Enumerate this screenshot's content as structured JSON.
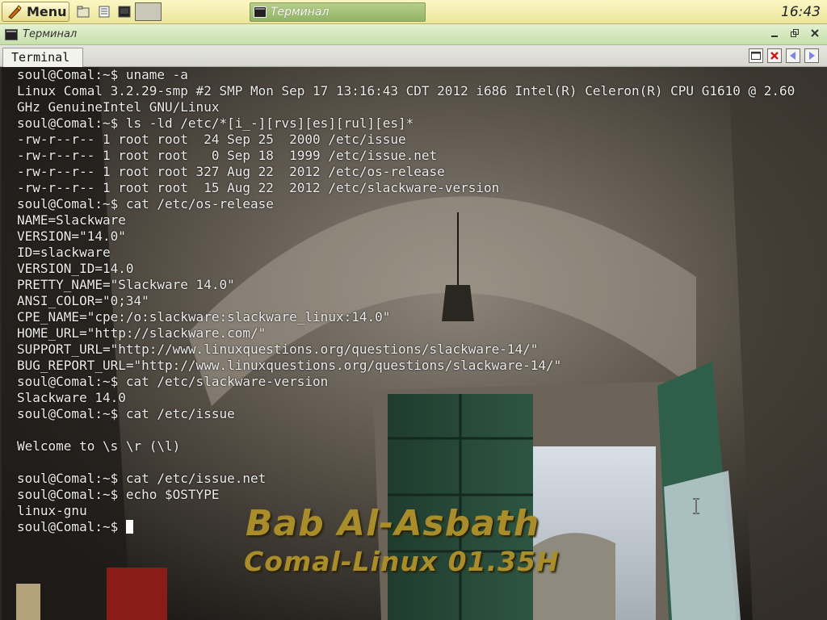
{
  "panel": {
    "menu_label": "Menu",
    "task_title": "Терминал",
    "clock": "16:43",
    "launchers": [
      "files-icon",
      "notes-icon",
      "terminal-icon"
    ]
  },
  "window": {
    "title": "Терминал",
    "tab_label": "Terminal"
  },
  "terminal": {
    "lines": [
      "soul@Comal:~$ uname -a",
      "Linux Comal 3.2.29-smp #2 SMP Mon Sep 17 13:16:43 CDT 2012 i686 Intel(R) Celeron(R) CPU G1610 @ 2.60",
      "GHz GenuineIntel GNU/Linux",
      "soul@Comal:~$ ls -ld /etc/*[i_-][rvs][es][rul][es]*",
      "-rw-r--r-- 1 root root  24 Sep 25  2000 /etc/issue",
      "-rw-r--r-- 1 root root   0 Sep 18  1999 /etc/issue.net",
      "-rw-r--r-- 1 root root 327 Aug 22  2012 /etc/os-release",
      "-rw-r--r-- 1 root root  15 Aug 22  2012 /etc/slackware-version",
      "soul@Comal:~$ cat /etc/os-release",
      "NAME=Slackware",
      "VERSION=\"14.0\"",
      "ID=slackware",
      "VERSION_ID=14.0",
      "PRETTY_NAME=\"Slackware 14.0\"",
      "ANSI_COLOR=\"0;34\"",
      "CPE_NAME=\"cpe:/o:slackware:slackware_linux:14.0\"",
      "HOME_URL=\"http://slackware.com/\"",
      "SUPPORT_URL=\"http://www.linuxquestions.org/questions/slackware-14/\"",
      "BUG_REPORT_URL=\"http://www.linuxquestions.org/questions/slackware-14/\"",
      "soul@Comal:~$ cat /etc/slackware-version",
      "Slackware 14.0",
      "soul@Comal:~$ cat /etc/issue",
      "",
      "Welcome to \\s \\r (\\l)",
      "",
      "soul@Comal:~$ cat /etc/issue.net",
      "soul@Comal:~$ echo $OSTYPE",
      "linux-gnu"
    ],
    "prompt": "soul@Comal:~$ "
  },
  "wallpaper": {
    "line1": "Bab Al-Asbath",
    "line2": "Comal-Linux 01.35H"
  }
}
